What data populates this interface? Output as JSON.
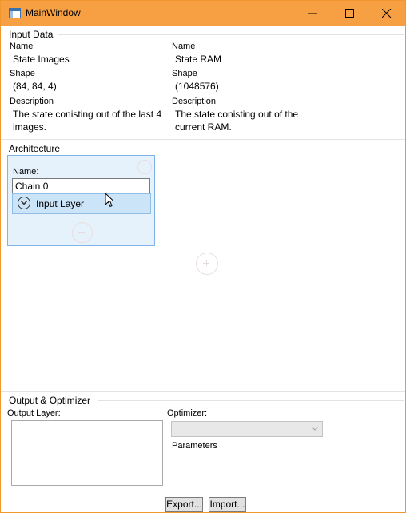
{
  "window": {
    "title": "MainWindow",
    "icons": [
      "minimize-icon",
      "maximize-icon",
      "close-icon"
    ]
  },
  "input_data": {
    "header": "Input Data",
    "inputs": [
      {
        "name_label": "Name",
        "name": "State Images",
        "shape_label": "Shape",
        "shape": "(84, 84, 4)",
        "description_label": "Description",
        "description_line1": "The state conisting out of the last 4",
        "description_line2": "images."
      },
      {
        "name_label": "Name",
        "name": "State RAM",
        "shape_label": "Shape",
        "shape": "(1048576)",
        "description_label": "Description",
        "description_line1": "The state conisting out of the",
        "description_line2": "current RAM."
      }
    ]
  },
  "architecture": {
    "header": "Architecture",
    "chain": {
      "name_label": "Name:",
      "name_value": "Chain 0",
      "layer_label": "Input Layer"
    }
  },
  "output": {
    "header": "Output & Optimizer",
    "output_layer_label": "Output Layer:",
    "optimizer_label": "Optimizer:",
    "optimizer_value": "",
    "parameters_label": "Parameters"
  },
  "footer": {
    "export_label": "Export...",
    "import_label": "Import..."
  },
  "colors": {
    "titlebar": "#f7a043",
    "selection": "#cce4f7",
    "chain_bg": "#e5f1fb",
    "chain_border": "#7eb4ea"
  }
}
